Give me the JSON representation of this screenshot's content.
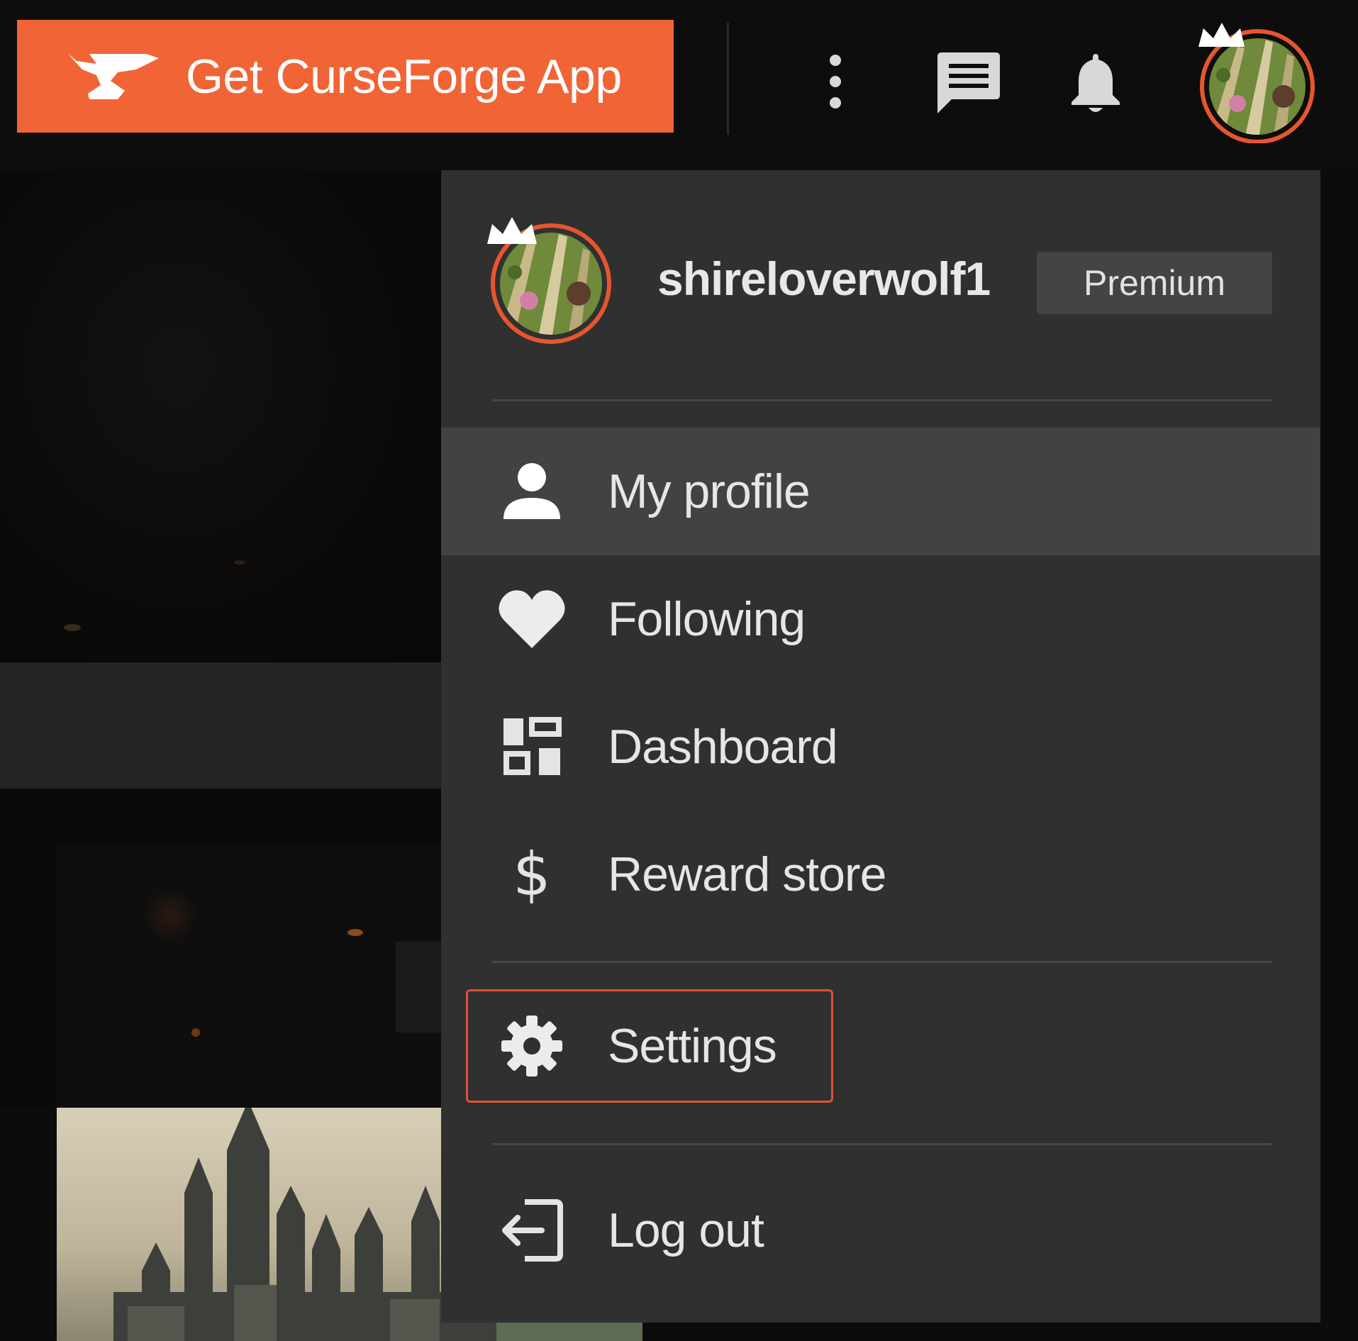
{
  "header": {
    "get_app_label": "Get CurseForge App",
    "icons": [
      "anvil-logo-icon",
      "more-vertical-icon",
      "chat-icon",
      "bell-icon",
      "avatar-crown-icon"
    ]
  },
  "user_menu": {
    "username": "shireloverwolf1",
    "badge": "Premium",
    "items": [
      {
        "label": "My profile",
        "icon": "person-icon"
      },
      {
        "label": "Following",
        "icon": "heart-icon"
      },
      {
        "label": "Dashboard",
        "icon": "dashboard-icon"
      },
      {
        "label": "Reward store",
        "icon": "dollar-icon"
      },
      {
        "label": "Settings",
        "icon": "gear-icon"
      },
      {
        "label": "Log out",
        "icon": "logout-icon"
      }
    ]
  },
  "colors": {
    "brand": "#f16436",
    "menu_bg": "#303030",
    "active_item": "#424242",
    "highlight_border": "#e0503a"
  }
}
